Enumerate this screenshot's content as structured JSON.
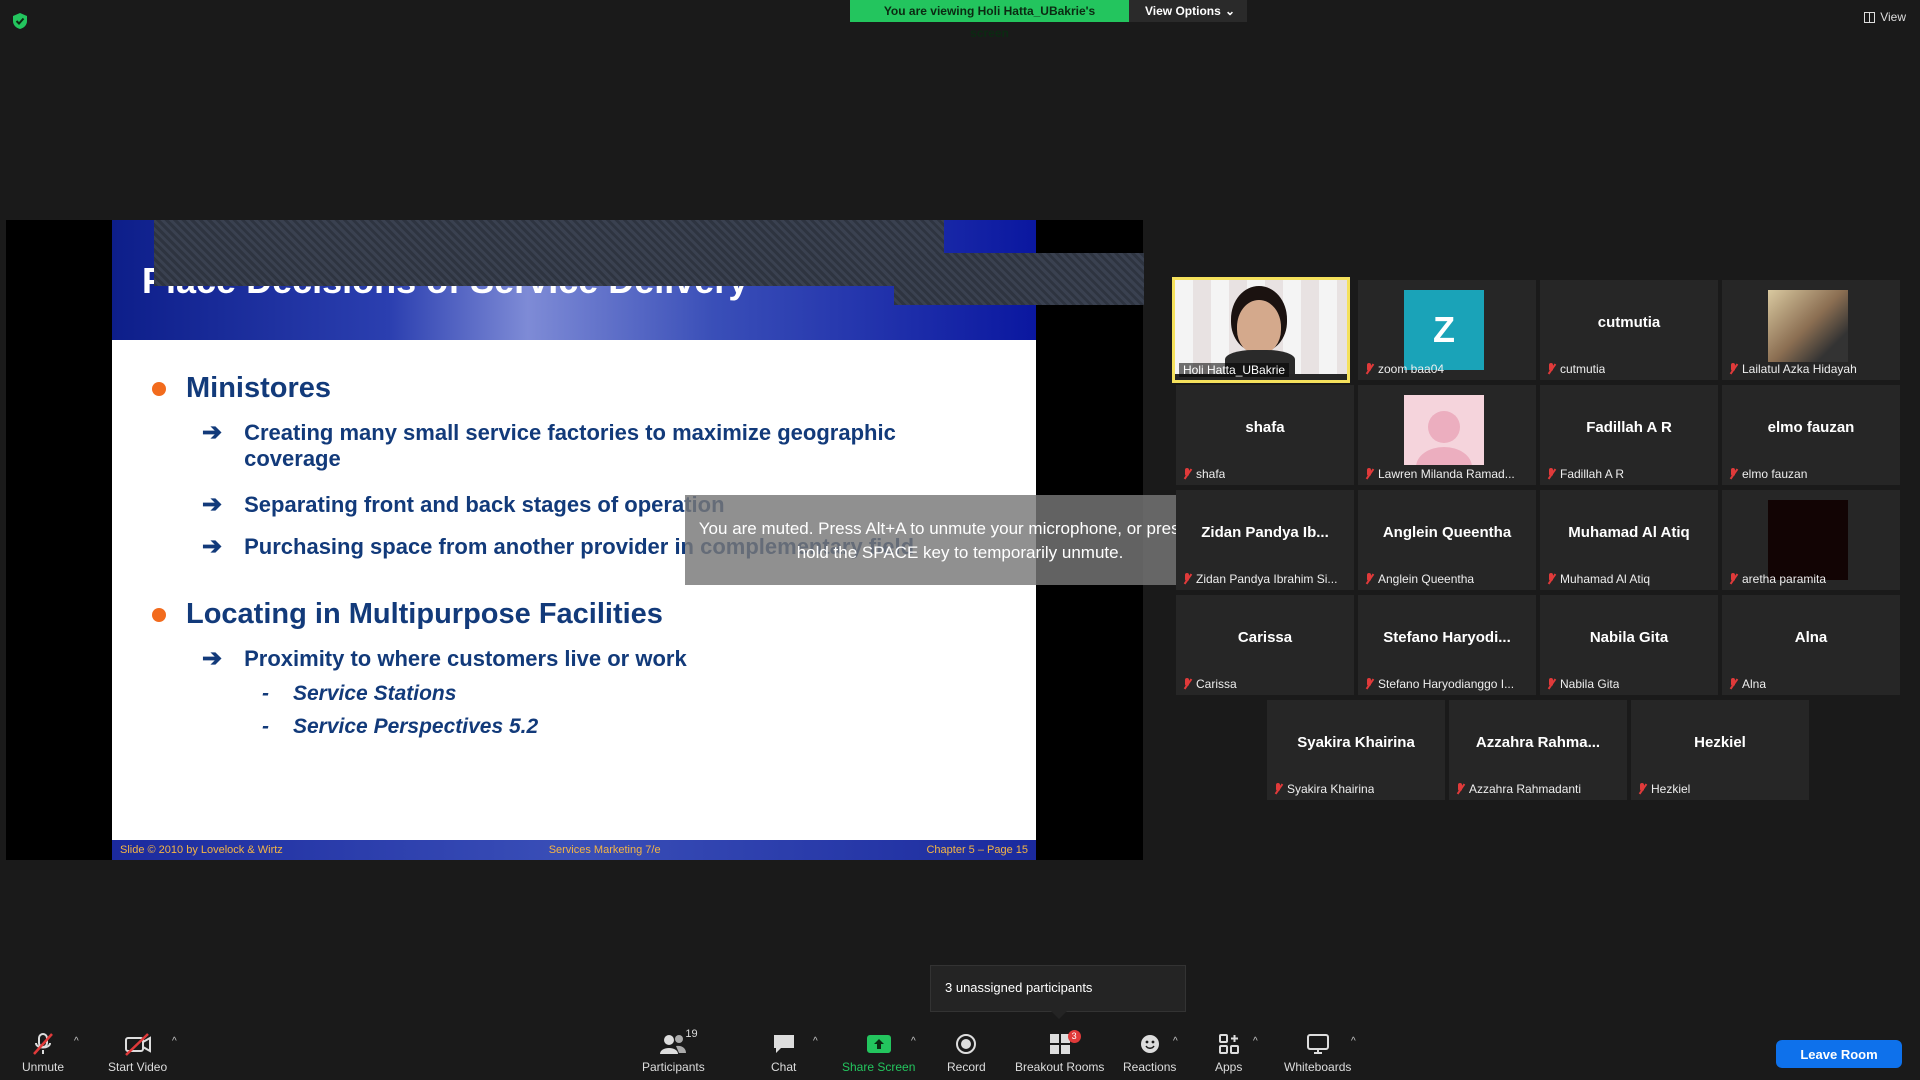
{
  "top": {
    "viewing_text": "You are viewing Holi Hatta_UBakrie's screen",
    "view_options": "View Options",
    "view": "View"
  },
  "slide": {
    "title": "Place Decisions of Service Delivery",
    "bullets": [
      "Ministores",
      "Locating in Multipurpose Facilities"
    ],
    "sub1": [
      "Creating many small service factories to maximize geographic coverage",
      "Separating front and back stages of operation",
      "Purchasing space from another provider in complementary field"
    ],
    "sub2": [
      "Proximity to where customers live or work"
    ],
    "sub3": [
      "Service Stations",
      "Service Perspectives 5.2"
    ],
    "footer_left": "Slide © 2010 by Lovelock & Wirtz",
    "footer_center": "Services Marketing 7/e",
    "footer_right": "Chapter 5 – Page 15"
  },
  "toast": "You are muted. Press Alt+A to unmute your microphone, or press and hold the SPACE key to temporarily unmute.",
  "participants": [
    {
      "center": "",
      "caption": "Holi Hatta_UBakrie"
    },
    {
      "center": "Z",
      "caption": "zoom baa04"
    },
    {
      "center": "cutmutia",
      "caption": "cutmutia"
    },
    {
      "center": "",
      "caption": "Lailatul Azka Hidayah"
    },
    {
      "center": "shafa",
      "caption": "shafa"
    },
    {
      "center": "",
      "caption": "Lawren Milanda Ramad..."
    },
    {
      "center": "Fadillah A R",
      "caption": "Fadillah A R"
    },
    {
      "center": "elmo fauzan",
      "caption": "elmo fauzan"
    },
    {
      "center": "Zidan  Pandya  Ib...",
      "caption": "Zidan Pandya Ibrahim Si..."
    },
    {
      "center": "Anglein Queentha",
      "caption": "Anglein Queentha"
    },
    {
      "center": "Muhamad Al Atiq",
      "caption": "Muhamad Al Atiq"
    },
    {
      "center": "",
      "caption": "aretha paramita"
    },
    {
      "center": "Carissa",
      "caption": "Carissa"
    },
    {
      "center": "Stefano  Haryodi...",
      "caption": "Stefano Haryodianggo I..."
    },
    {
      "center": "Nabila Gita",
      "caption": "Nabila Gita"
    },
    {
      "center": "Alna",
      "caption": "Alna"
    },
    {
      "center": "Syakira Khairina",
      "caption": "Syakira Khairina"
    },
    {
      "center": "Azzahra  Rahma...",
      "caption": "Azzahra Rahmadanti"
    },
    {
      "center": "Hezkiel",
      "caption": "Hezkiel"
    }
  ],
  "tooltip": "3 unassigned participants",
  "toolbar": {
    "unmute": "Unmute",
    "start_video": "Start Video",
    "participants": "Participants",
    "participants_count": "19",
    "chat": "Chat",
    "share_screen": "Share Screen",
    "record": "Record",
    "breakout_rooms": "Breakout Rooms",
    "breakout_badge": "3",
    "reactions": "Reactions",
    "apps": "Apps",
    "whiteboards": "Whiteboards",
    "leave_room": "Leave Room"
  },
  "colors": {
    "banner_green": "#23c55e",
    "slide_blue": "#123a7a",
    "bullet_orange": "#f26b1d",
    "leave_blue": "#0e71eb",
    "active_border": "#f5e15c"
  }
}
